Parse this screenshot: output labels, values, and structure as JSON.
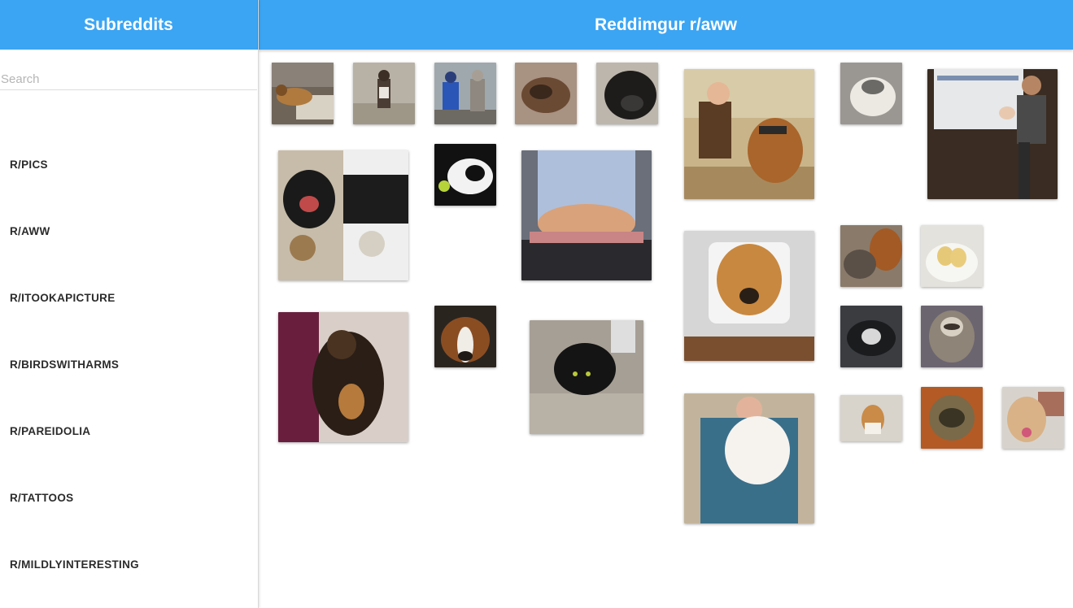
{
  "sidebar": {
    "title": "Subreddits",
    "search_placeholder": "Search",
    "items": [
      {
        "label": "R/PICS"
      },
      {
        "label": "R/AWW"
      },
      {
        "label": "R/ITOOKAPICTURE"
      },
      {
        "label": "R/BIRDSWITHARMS"
      },
      {
        "label": "R/PAREIDOLIA"
      },
      {
        "label": "R/TATTOOS"
      },
      {
        "label": "R/MILDLYINTERESTING"
      }
    ]
  },
  "main": {
    "title": "Reddimgur r/aww"
  },
  "gallery": {
    "images": [
      {
        "name": "dog-lying-on-bed-image"
      },
      {
        "name": "dog-standing-on-street-image"
      },
      {
        "name": "child-with-husky-image"
      },
      {
        "name": "dog-curled-up-image"
      },
      {
        "name": "black-dog-closeup-image"
      },
      {
        "name": "boy-with-dog-image"
      },
      {
        "name": "husky-puppy-image"
      },
      {
        "name": "man-with-baby-presentation-image"
      },
      {
        "name": "black-dogs-with-toys-image"
      },
      {
        "name": "puppy-with-ball-image"
      },
      {
        "name": "cat-by-window-image"
      },
      {
        "name": "dog-in-cat-door-image"
      },
      {
        "name": "cats-and-boxer-image"
      },
      {
        "name": "ducklings-in-bowl-image"
      },
      {
        "name": "calico-cat-held-image"
      },
      {
        "name": "beagle-face-image"
      },
      {
        "name": "black-cat-outdoors-image"
      },
      {
        "name": "cat-in-car-image"
      },
      {
        "name": "sloth-image"
      },
      {
        "name": "man-holding-white-cat-image"
      },
      {
        "name": "corgi-puppy-image"
      },
      {
        "name": "puppy-in-food-bowl-image"
      },
      {
        "name": "happy-lab-image"
      }
    ]
  },
  "colors": {
    "header": "#3ba5f3",
    "header_text": "#ffffff"
  }
}
